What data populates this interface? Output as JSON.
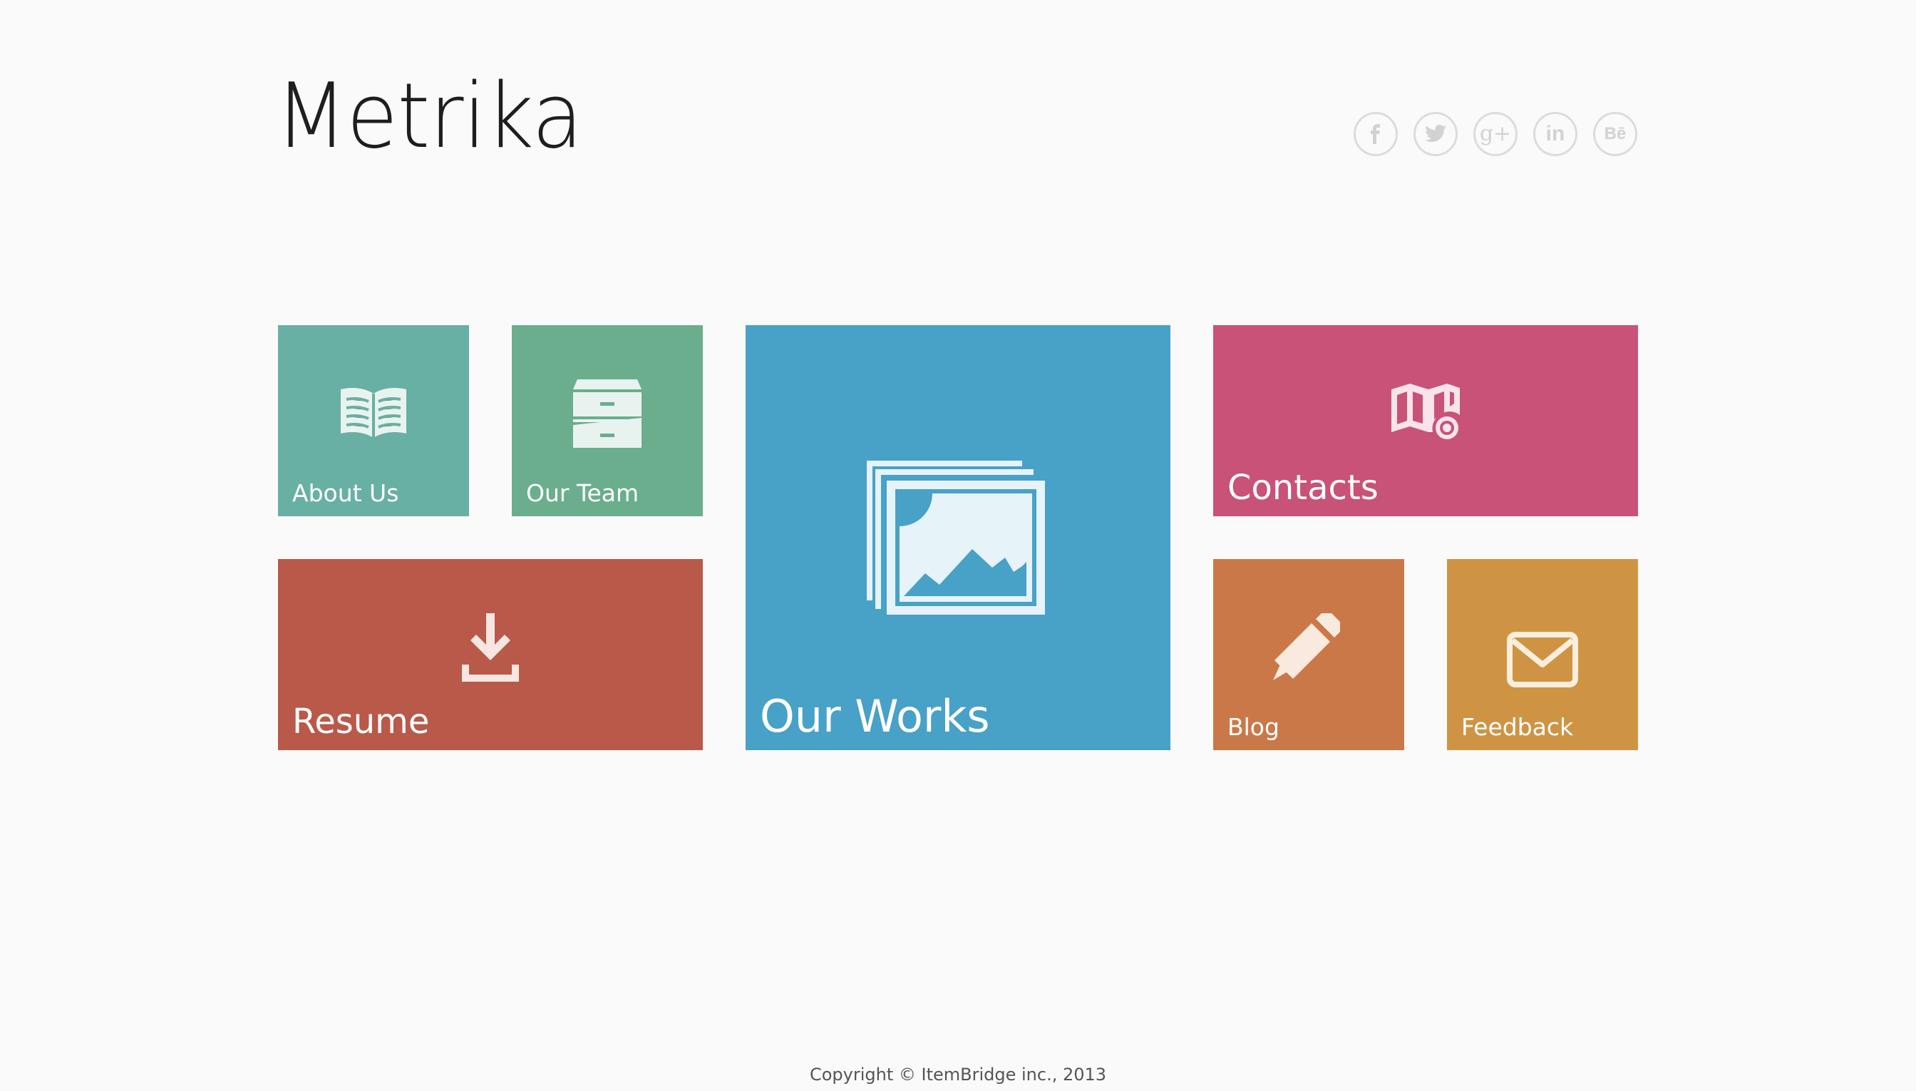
{
  "brand": {
    "name": "Metrika"
  },
  "social": [
    {
      "icon": "facebook-icon"
    },
    {
      "icon": "twitter-icon"
    },
    {
      "icon": "google-plus-icon",
      "glyph": "g+"
    },
    {
      "icon": "linkedin-icon",
      "glyph": "in"
    },
    {
      "icon": "behance-icon",
      "glyph": "Bē"
    }
  ],
  "tiles": {
    "about": {
      "label": "About Us",
      "icon": "book-icon",
      "color": "#68b0a3"
    },
    "team": {
      "label": "Our Team",
      "icon": "cabinet-icon",
      "color": "#6aae8e"
    },
    "works": {
      "label": "Our Works",
      "icon": "gallery-icon",
      "color": "#48a1c7"
    },
    "contacts": {
      "label": "Contacts",
      "icon": "map-pin-icon",
      "color": "#c85278"
    },
    "resume": {
      "label": "Resume",
      "icon": "download-icon",
      "color": "#b95949"
    },
    "blog": {
      "label": "Blog",
      "icon": "pencil-icon",
      "color": "#cb7848"
    },
    "feedback": {
      "label": "Feedback",
      "icon": "envelope-icon",
      "color": "#cf9443"
    }
  },
  "footer": {
    "copyright": "Copyright © ItemBridge inc., 2013"
  }
}
